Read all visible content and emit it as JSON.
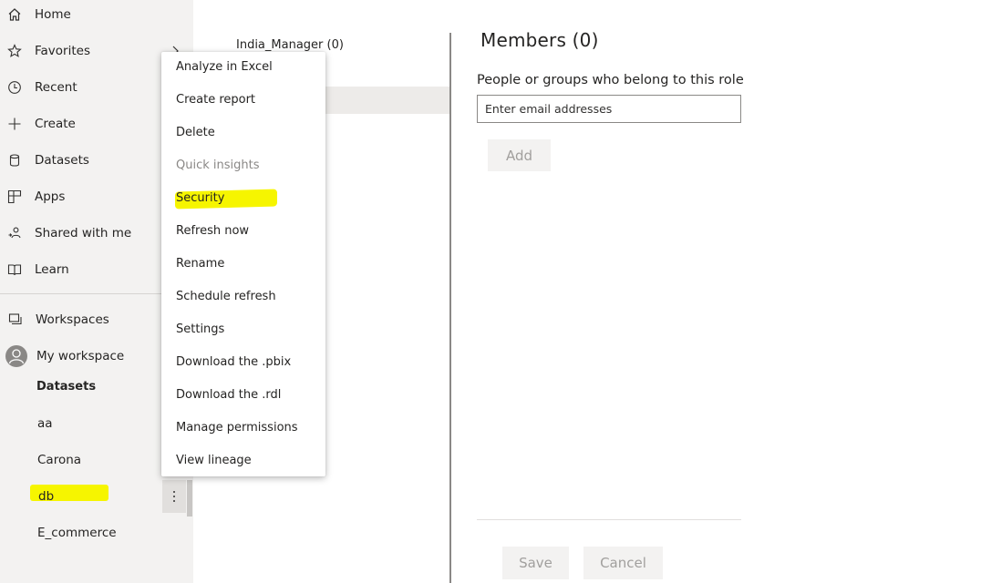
{
  "nav": {
    "items": [
      {
        "label": "Home",
        "icon": "home-icon"
      },
      {
        "label": "Favorites",
        "icon": "star-icon"
      },
      {
        "label": "Recent",
        "icon": "clock-icon"
      },
      {
        "label": "Create",
        "icon": "plus-icon"
      },
      {
        "label": "Datasets",
        "icon": "database-icon"
      },
      {
        "label": "Apps",
        "icon": "apps-icon"
      },
      {
        "label": "Shared with me",
        "icon": "shared-icon"
      },
      {
        "label": "Learn",
        "icon": "book-icon"
      }
    ],
    "workspaces_label": "Workspaces",
    "my_workspace_label": "My workspace",
    "section_label": "Datasets",
    "datasets": [
      "aa",
      "Carona",
      "db",
      "E_commerce"
    ],
    "selected_dataset": "db"
  },
  "roles": {
    "first_role": "India_Manager (0)"
  },
  "members": {
    "title": "Members (0)",
    "description": "People or groups who belong to this role",
    "email_placeholder": "Enter email addresses",
    "add_label": "Add",
    "save_label": "Save",
    "cancel_label": "Cancel"
  },
  "context_menu": {
    "items": [
      {
        "label": "Analyze in Excel",
        "disabled": false
      },
      {
        "label": "Create report",
        "disabled": false
      },
      {
        "label": "Delete",
        "disabled": false
      },
      {
        "label": "Quick insights",
        "disabled": true
      },
      {
        "label": "Security",
        "disabled": false,
        "highlighted": true
      },
      {
        "label": "Refresh now",
        "disabled": false
      },
      {
        "label": "Rename",
        "disabled": false
      },
      {
        "label": "Schedule refresh",
        "disabled": false
      },
      {
        "label": "Settings",
        "disabled": false
      },
      {
        "label": "Download the .pbix",
        "disabled": false
      },
      {
        "label": "Download the .rdl",
        "disabled": false
      },
      {
        "label": "Manage permissions",
        "disabled": false
      },
      {
        "label": "View lineage",
        "disabled": false
      }
    ]
  },
  "colors": {
    "highlight": "#f6f500",
    "nav_background": "#f3f2f1",
    "text": "#252423",
    "disabled_text": "#8a8886"
  }
}
